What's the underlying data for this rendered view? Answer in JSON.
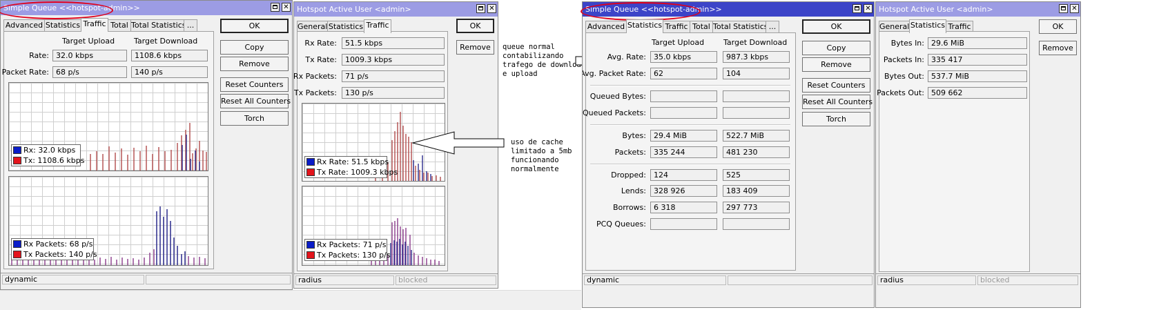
{
  "win_queue": {
    "title": "Simple Queue <<hotspot-admin>>",
    "tabs": [
      "Advanced",
      "Statistics",
      "Traffic",
      "Total",
      "Total Statistics",
      "..."
    ],
    "active_tab": "Traffic",
    "col_upload": "Target Upload",
    "col_download": "Target Download",
    "rate_label": "Rate:",
    "rate_up": "32.0 kbps",
    "rate_down": "1108.6 kbps",
    "packet_rate_label": "Packet Rate:",
    "packet_up": "68 p/s",
    "packet_down": "140 p/s",
    "graph1_legend": [
      "Rx:  32.0 kbps",
      "Tx:  1108.6 kbps"
    ],
    "graph2_legend": [
      "Rx Packets:  68 p/s",
      "Tx Packets:  140 p/s"
    ],
    "buttons": [
      "OK",
      "Copy",
      "Remove",
      "Reset Counters",
      "Reset All Counters",
      "Torch"
    ],
    "status": "dynamic"
  },
  "win_hotspot": {
    "title": "Hotspot Active User <admin>",
    "tabs": [
      "General",
      "Statistics",
      "Traffic"
    ],
    "active_tab": "Traffic",
    "rows": [
      {
        "label": "Rx Rate:",
        "value": "51.5 kbps"
      },
      {
        "label": "Tx Rate:",
        "value": "1009.3 kbps"
      },
      {
        "label": "Rx Packets:",
        "value": "71 p/s"
      },
      {
        "label": "Tx Packets:",
        "value": "130 p/s"
      }
    ],
    "graph1_legend": [
      "Rx Rate:  51.5 kbps",
      "Tx Rate:  1009.3 kbps"
    ],
    "graph2_legend": [
      "Rx Packets:  71 p/s",
      "Tx Packets:  130 p/s"
    ],
    "buttons": [
      "OK",
      "Remove"
    ],
    "status_left": "radius",
    "status_right": "blocked"
  },
  "annotations": {
    "note1": "queue normal\ncontabilizando\ntrafego de download\ne upload",
    "note2": "uso de cache\nlimitado a 5mb\nfuncionando\nnormalmente"
  },
  "win_queue2": {
    "title": "Simple Queue <<hotspot-admin>>",
    "tabs": [
      "Advanced",
      "Statistics",
      "Traffic",
      "Total",
      "Total Statistics",
      "..."
    ],
    "active_tab": "Statistics",
    "col_upload": "Target Upload",
    "col_download": "Target Download",
    "rows": [
      {
        "label": "Avg. Rate:",
        "up": "35.0 kbps",
        "down": "987.3 kbps"
      },
      {
        "label": "Avg. Packet Rate:",
        "up": "62",
        "down": "104"
      },
      {
        "label": "Queued Bytes:",
        "up": "",
        "down": ""
      },
      {
        "label": "Queued Packets:",
        "up": "",
        "down": ""
      },
      {
        "label": "Bytes:",
        "up": "29.4 MiB",
        "down": "522.7 MiB"
      },
      {
        "label": "Packets:",
        "up": "335 244",
        "down": "481 230"
      },
      {
        "label": "Dropped:",
        "up": "124",
        "down": "525"
      },
      {
        "label": "Lends:",
        "up": "328 926",
        "down": "183 409"
      },
      {
        "label": "Borrows:",
        "up": "6 318",
        "down": "297 773"
      },
      {
        "label": "PCQ Queues:",
        "up": "",
        "down": ""
      }
    ],
    "buttons": [
      "OK",
      "Copy",
      "Remove",
      "Reset Counters",
      "Reset All Counters",
      "Torch"
    ],
    "status": "dynamic"
  },
  "win_hotspot2": {
    "title": "Hotspot Active User <admin>",
    "tabs": [
      "General",
      "Statistics",
      "Traffic"
    ],
    "active_tab": "Statistics",
    "rows": [
      {
        "label": "Bytes In:",
        "value": "29.6 MiB"
      },
      {
        "label": "Packets In:",
        "value": "335 417"
      },
      {
        "label": "Bytes Out:",
        "value": "537.7 MiB"
      },
      {
        "label": "Packets Out:",
        "value": "509 662"
      }
    ],
    "buttons": [
      "OK",
      "Remove"
    ],
    "status_left": "radius",
    "status_right": "blocked"
  },
  "colors": {
    "rx": "#0a1cc8",
    "tx": "#e3141c",
    "title_active": "#3c44c8",
    "title_inactive": "#9c9ce4",
    "highlight_ring": "#e0001a",
    "bar_rx": "#2a2a8c",
    "bar_tx": "#b04a4a"
  }
}
